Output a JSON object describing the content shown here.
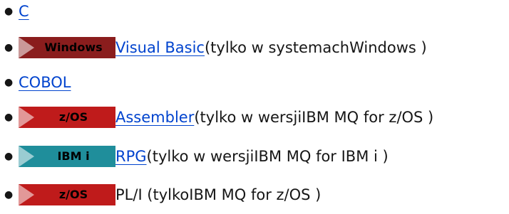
{
  "colors": {
    "windows_badge": "#8a1d1d",
    "zos_badge": "#bf1b1b",
    "ibmi_badge": "#1f8e9b",
    "link": "#0043ce"
  },
  "items": [
    {
      "link": "C",
      "text": ""
    },
    {
      "badge": "Windows",
      "link": "Visual Basic",
      "text": " (tylko w systemachWindows )"
    },
    {
      "link": "COBOL",
      "text": ""
    },
    {
      "badge": "z/OS",
      "link": "Assembler",
      "text": " (tylko w wersjiIBM MQ for z/OS )"
    },
    {
      "badge": "IBM i",
      "link": "RPG",
      "text": " (tylko w wersjiIBM MQ for IBM i )"
    },
    {
      "badge": "z/OS",
      "link": "",
      "text": "PL/I (tylkoIBM MQ for z/OS )"
    }
  ]
}
